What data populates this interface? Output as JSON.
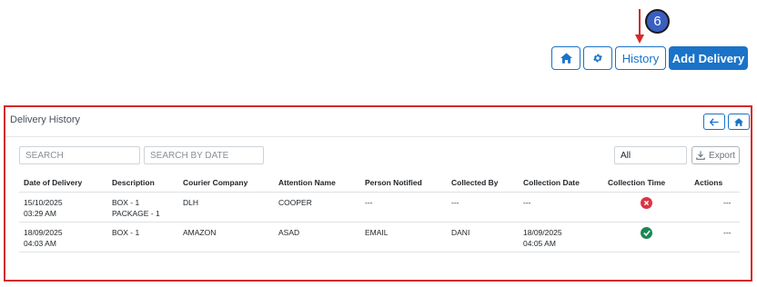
{
  "annotation": {
    "step_number": "6"
  },
  "toolbar": {
    "home_icon": "home-icon",
    "settings_icon": "gear-icon",
    "history_label": "History",
    "add_delivery_label": "Add Delivery",
    "accent_color": "#1a73c8"
  },
  "panel": {
    "title": "Delivery History",
    "back_icon": "arrow-left-icon",
    "home_icon": "home-icon",
    "search_placeholder": "SEARCH",
    "date_search_placeholder": "SEARCH BY DATE",
    "filter_value": "All",
    "export_label": "Export"
  },
  "table": {
    "columns": [
      "Date of Delivery",
      "Description",
      "Courier Company",
      "Attention Name",
      "Person Notified",
      "Collected By",
      "Collection Date",
      "Collection Time",
      "Actions"
    ],
    "rows": [
      {
        "date_line1": "15/10/2025",
        "date_line2": "03:29 AM",
        "description_line1": "BOX - 1",
        "description_line2": "PACKAGE - 1",
        "courier": "DLH",
        "attention_name": "COOPER",
        "person_notified": "---",
        "collected_by": "---",
        "collection_date_line1": "---",
        "collection_date_line2": "",
        "collection_status": "not-collected",
        "status_icon": "x-circle-icon",
        "actions": "---"
      },
      {
        "date_line1": "18/09/2025",
        "date_line2": "04:03 AM",
        "description_line1": "BOX - 1",
        "description_line2": "",
        "courier": "AMAZON",
        "attention_name": "ASAD",
        "person_notified": "EMAIL",
        "collected_by": "DANI",
        "collection_date_line1": "18/09/2025",
        "collection_date_line2": "04:05 AM",
        "collection_status": "collected",
        "status_icon": "check-circle-icon",
        "actions": "---"
      }
    ]
  }
}
